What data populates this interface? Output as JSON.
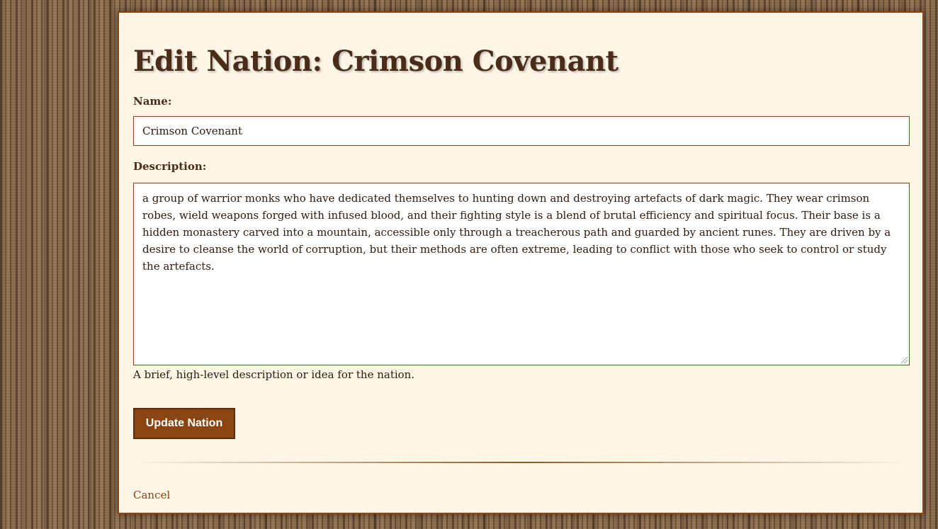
{
  "page": {
    "title": "Edit Nation: Crimson Covenant"
  },
  "form": {
    "name_label": "Name:",
    "name_value": "Crimson Covenant",
    "description_label": "Description:",
    "description_value": "a group of warrior monks who have dedicated themselves to hunting down and destroying artefacts of dark magic. They wear crimson robes, wield weapons forged with infused blood, and their fighting style is a blend of brutal efficiency and spiritual focus. Their base is a hidden monastery carved into a mountain, accessible only through a treacherous path and guarded by ancient runes. They are driven by a desire to cleanse the world of corruption, but their methods are often extreme, leading to conflict with those who seek to control or study the artefacts.",
    "description_help": "A brief, high-level description or idea for the nation.",
    "submit_label": "Update Nation"
  },
  "footer": {
    "cancel_label": "Cancel"
  },
  "colors": {
    "accent": "#8b4513",
    "panel_bg": "#fdf5e6",
    "heading": "#4a2c1a"
  }
}
